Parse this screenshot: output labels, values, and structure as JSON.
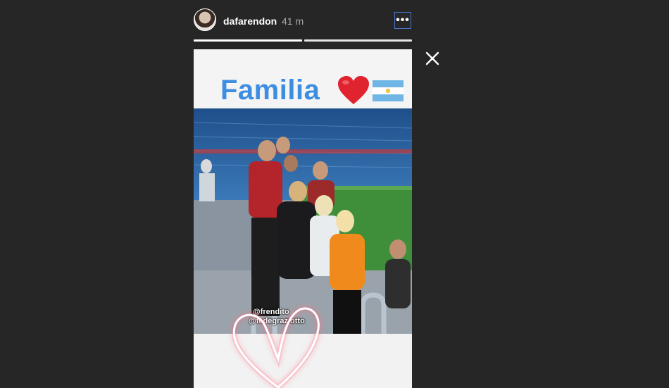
{
  "header": {
    "username": "dafarendon",
    "time": "41 m",
    "more_icon": "more-options-icon"
  },
  "progress": {
    "segments": 2,
    "current": 1
  },
  "story": {
    "title": "Familia",
    "emojis": [
      "red-heart-icon",
      "argentina-flag-icon"
    ],
    "mentions": [
      "@frendito",
      "@fedegraziotto"
    ],
    "sticker": "neon-heart-icon"
  },
  "controls": {
    "close_icon": "close-icon"
  },
  "colors": {
    "background": "#262626",
    "title_blue": "#3d8ee0",
    "accent_border": "#4a74c9"
  }
}
